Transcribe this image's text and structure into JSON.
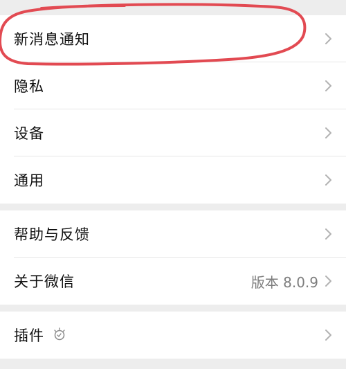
{
  "settings": {
    "group1": {
      "items": [
        {
          "label": "新消息通知"
        },
        {
          "label": "隐私"
        },
        {
          "label": "设备"
        },
        {
          "label": "通用"
        }
      ]
    },
    "group2": {
      "items": [
        {
          "label": "帮助与反馈"
        },
        {
          "label": "关于微信",
          "value": "版本 8.0.9"
        }
      ]
    },
    "group3": {
      "items": [
        {
          "label": "插件",
          "icon": "bulb-icon"
        }
      ]
    }
  },
  "colors": {
    "background": "#ededed",
    "row_background": "#ffffff",
    "text": "#111111",
    "secondary_text": "#7d7d7d",
    "chevron": "#b2b2b2",
    "annotation": "#e24a52"
  },
  "icons": {
    "chevron": "chevron-right-icon"
  }
}
